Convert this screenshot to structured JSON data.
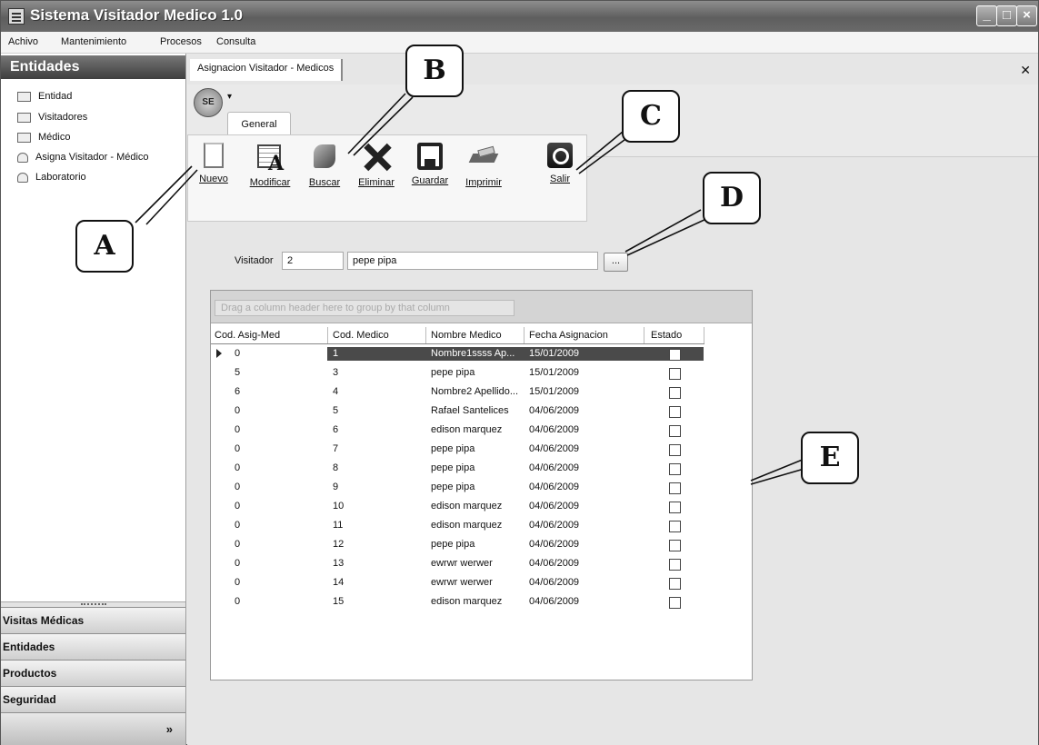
{
  "window": {
    "title": "Sistema Visitador Medico 1.0"
  },
  "menu": [
    "Achivo",
    "Mantenimiento",
    "Procesos",
    "Consulta"
  ],
  "sidebar": {
    "header": "Entidades",
    "items": [
      {
        "label": "Entidad",
        "icon": "table-icon"
      },
      {
        "label": "Visitadores",
        "icon": "table-icon"
      },
      {
        "label": "Médico",
        "icon": "table-icon"
      },
      {
        "label": "Asigna Visitador - Médico",
        "icon": "people-icon"
      },
      {
        "label": "Laboratorio",
        "icon": "people-icon"
      }
    ],
    "groups": [
      "Visitas Médicas",
      "Entidades",
      "Productos",
      "Seguridad"
    ]
  },
  "document_tab": {
    "label": "Asignacion Visitador - Medicos"
  },
  "ribbon": {
    "tab": "General",
    "buttons": [
      "Nuevo",
      "Modificar",
      "Buscar",
      "Eliminar",
      "Guardar",
      "Imprimir",
      "Salir"
    ]
  },
  "visitor": {
    "label": "Visitador",
    "code": "2",
    "name": "pepe pipa",
    "lookup_label": "..."
  },
  "grid": {
    "group_hint": "Drag a column header here to group by that column",
    "columns": [
      "Cod. Asig-Med",
      "Cod. Medico",
      "Nombre Medico",
      "Fecha Asignacion",
      "Estado"
    ],
    "rows": [
      {
        "asig": "0",
        "medico": "1",
        "nombre": "Nombre1ssss Ap...",
        "fecha": "15/01/2009",
        "estado": false,
        "selected": true
      },
      {
        "asig": "5",
        "medico": "3",
        "nombre": "pepe pipa",
        "fecha": "15/01/2009",
        "estado": false
      },
      {
        "asig": "6",
        "medico": "4",
        "nombre": "Nombre2 Apellido...",
        "fecha": "15/01/2009",
        "estado": false
      },
      {
        "asig": "0",
        "medico": "5",
        "nombre": "Rafael Santelices",
        "fecha": "04/06/2009",
        "estado": false
      },
      {
        "asig": "0",
        "medico": "6",
        "nombre": "edison marquez",
        "fecha": "04/06/2009",
        "estado": false
      },
      {
        "asig": "0",
        "medico": "7",
        "nombre": "pepe pipa",
        "fecha": "04/06/2009",
        "estado": false
      },
      {
        "asig": "0",
        "medico": "8",
        "nombre": "pepe pipa",
        "fecha": "04/06/2009",
        "estado": false
      },
      {
        "asig": "0",
        "medico": "9",
        "nombre": "pepe pipa",
        "fecha": "04/06/2009",
        "estado": false
      },
      {
        "asig": "0",
        "medico": "10",
        "nombre": "edison marquez",
        "fecha": "04/06/2009",
        "estado": false
      },
      {
        "asig": "0",
        "medico": "11",
        "nombre": "edison marquez",
        "fecha": "04/06/2009",
        "estado": false
      },
      {
        "asig": "0",
        "medico": "12",
        "nombre": "pepe pipa",
        "fecha": "04/06/2009",
        "estado": false
      },
      {
        "asig": "0",
        "medico": "13",
        "nombre": "ewrwr werwer",
        "fecha": "04/06/2009",
        "estado": false
      },
      {
        "asig": "0",
        "medico": "14",
        "nombre": "ewrwr werwer",
        "fecha": "04/06/2009",
        "estado": false
      },
      {
        "asig": "0",
        "medico": "15",
        "nombre": "edison marquez",
        "fecha": "04/06/2009",
        "estado": false
      }
    ]
  },
  "callouts": [
    "A",
    "B",
    "C",
    "D",
    "E"
  ],
  "colors": {
    "titlebar": "#6a6a6a",
    "sidebar_header": "#3e3e3e",
    "selected_row": "#4a4a4a"
  }
}
